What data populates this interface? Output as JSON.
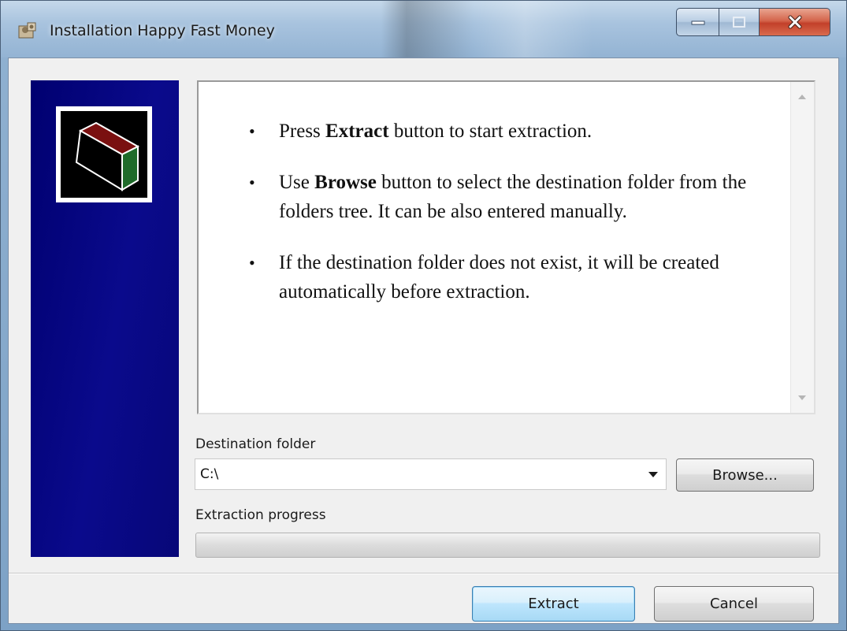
{
  "window": {
    "title": "Installation Happy Fast Money"
  },
  "caption_buttons": {
    "minimize_icon": "minimize-icon",
    "maximize_icon": "maximize-icon",
    "close_icon": "close-icon"
  },
  "info": {
    "bullets": [
      {
        "prefix": "Press ",
        "bold": "Extract",
        "suffix": " button to start extraction."
      },
      {
        "prefix": "Use ",
        "bold": "Browse",
        "suffix": " button to select the destination folder from the folders tree. It can be also entered manually."
      },
      {
        "prefix": "",
        "bold": "",
        "suffix": "If the destination folder does not exist, it will be created automatically before extraction."
      }
    ]
  },
  "destination": {
    "label": "Destination folder",
    "value": "C:\\",
    "browse_label": "Browse..."
  },
  "progress": {
    "label": "Extraction progress",
    "fraction": 0
  },
  "footer": {
    "extract_label": "Extract",
    "cancel_label": "Cancel"
  },
  "colors": {
    "side_panel": "#00007a",
    "logo_top": "#7a1010",
    "logo_side": "#1f6b2a"
  }
}
